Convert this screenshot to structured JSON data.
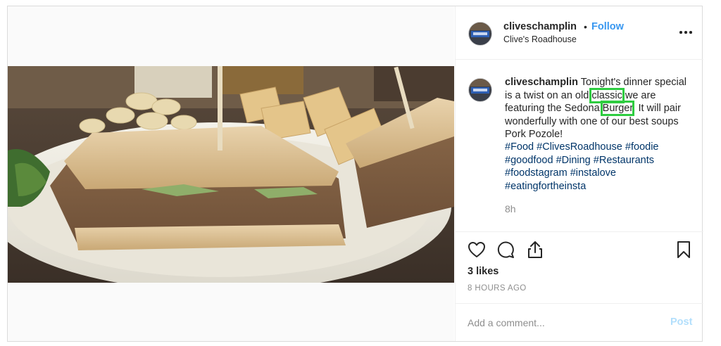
{
  "post": {
    "author": {
      "username": "cliveschamplin",
      "location": "Clive's Roadhouse"
    },
    "follow_label": "Follow",
    "separator": "•",
    "more_icon": "more-options-icon",
    "photo_alt": "Sandwich with fries on a plate",
    "caption": {
      "username": "cliveschamplin",
      "text_before_classic": " Tonight's dinner special is a twist on an old ",
      "highlight_1": "classic",
      "text_middle": " we are featuring the Sedona ",
      "highlight_2": "Burger",
      "text_after": ". It will pair wonderfully with one of our best soups Pork Pozole!",
      "highlight_color": "#2ecc40"
    },
    "hashtags": [
      "#Food",
      "#ClivesRoadhouse",
      "#foodie",
      "#goodfood",
      "#Dining",
      "#Restaurants",
      "#foodstagram",
      "#instalove",
      "#eatingfortheinsta"
    ],
    "relative_time": "8h",
    "actions": {
      "like_icon": "heart-icon",
      "comment_icon": "comment-icon",
      "share_icon": "share-icon",
      "save_icon": "bookmark-icon"
    },
    "likes": "3 likes",
    "time_ago": "8 HOURS AGO",
    "comment": {
      "placeholder": "Add a comment...",
      "post_label": "Post"
    },
    "colors": {
      "link_blue": "#3897f0",
      "hashtag": "#003569",
      "post_disabled": "#b2dffc",
      "muted": "#8e8e8e"
    }
  }
}
